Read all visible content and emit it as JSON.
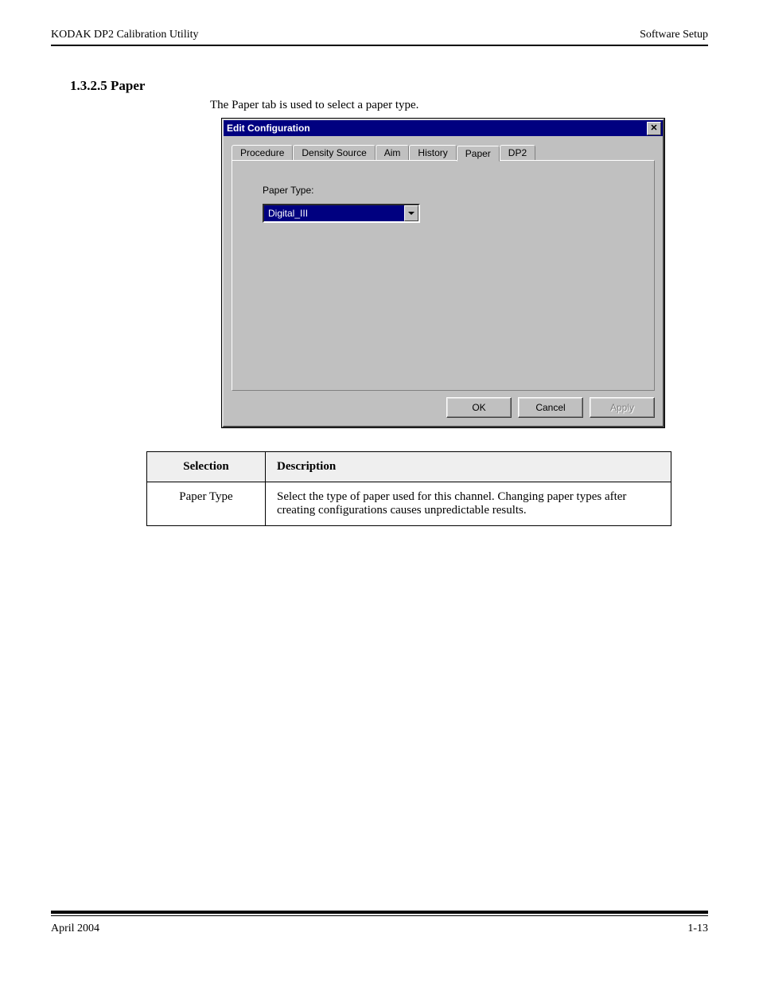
{
  "header": {
    "left": "KODAK DP2 Calibration Utility",
    "right": "Software Setup"
  },
  "section": {
    "number": "1.3.2.5 Paper",
    "intro": "The Paper tab is used to select a paper type."
  },
  "dialog": {
    "title": "Edit Configuration",
    "tabs": [
      "Procedure",
      "Density Source",
      "Aim",
      "History",
      "Paper",
      "DP2"
    ],
    "activeTab": "Paper",
    "paperTypeLabel": "Paper Type:",
    "paperTypeValue": "Digital_III",
    "buttons": {
      "ok": "OK",
      "cancel": "Cancel",
      "apply": "Apply"
    }
  },
  "table": {
    "headers": [
      "Selection",
      "Description"
    ],
    "rows": [
      {
        "selection": "Paper Type",
        "description": "Select the type of paper used for this channel. Changing paper types after creating configurations causes unpredictable results."
      }
    ]
  },
  "footer": {
    "left": "April 2004",
    "right": "1-13"
  }
}
